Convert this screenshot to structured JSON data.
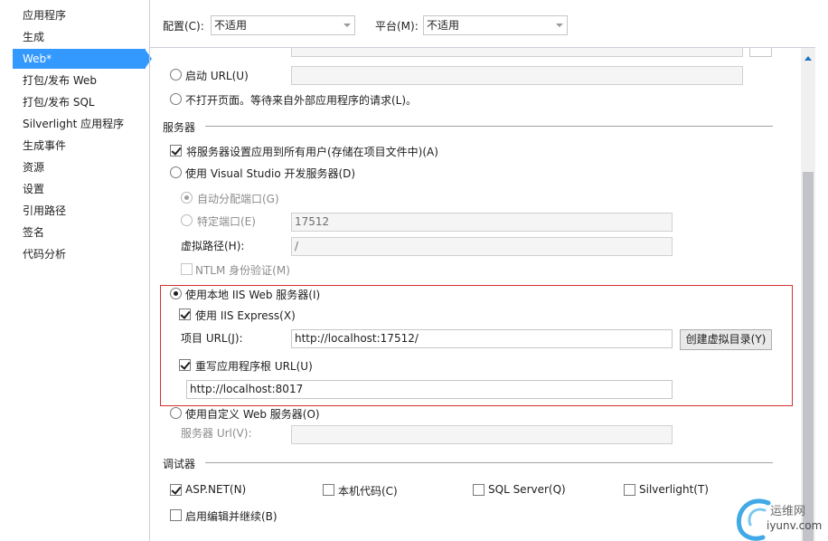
{
  "sidebar": {
    "items": [
      {
        "label": "应用程序"
      },
      {
        "label": "生成"
      },
      {
        "label": "Web*",
        "selected": true
      },
      {
        "label": "打包/发布 Web"
      },
      {
        "label": "打包/发布 SQL"
      },
      {
        "label": "Silverlight 应用程序"
      },
      {
        "label": "生成事件"
      },
      {
        "label": "资源"
      },
      {
        "label": "设置"
      },
      {
        "label": "引用路径"
      },
      {
        "label": "签名"
      },
      {
        "label": "代码分析"
      }
    ]
  },
  "toolbar": {
    "config_label": "配置(C):",
    "config_value": "不适用",
    "platform_label": "平台(M):",
    "platform_value": "不适用"
  },
  "start_action": {
    "start_url_label": "启动 URL(U)",
    "start_url_value": "",
    "no_open_label": "不打开页面。等待来自外部应用程序的请求(L)。"
  },
  "servers": {
    "title": "服务器",
    "apply_all_label": "将服务器设置应用到所有用户(存储在项目文件中)(A)",
    "apply_all_checked": true,
    "vs_dev_label": "使用 Visual Studio 开发服务器(D)",
    "auto_port_label": "自动分配端口(G)",
    "specific_port_label": "特定端口(E)",
    "specific_port_value": "17512",
    "virtual_path_label": "虚拟路径(H):",
    "virtual_path_value": "/",
    "ntlm_label": "NTLM 身份验证(M)",
    "local_iis_label": "使用本地 IIS Web 服务器(I)",
    "iis_express_label": "使用 IIS Express(X)",
    "iis_express_checked": true,
    "project_url_label": "项目 URL(J):",
    "project_url_value": "http://localhost:17512/",
    "create_vdir_button": "创建虚拟目录(Y)",
    "override_root_label": "重写应用程序根 URL(U)",
    "override_root_checked": true,
    "override_root_value": "http://localhost:8017",
    "custom_server_label": "使用自定义 Web 服务器(O)",
    "server_url_label": "服务器 Url(V):",
    "server_url_value": ""
  },
  "debuggers": {
    "title": "调试器",
    "aspnet_label": "ASP.NET(N)",
    "aspnet_checked": true,
    "native_label": "本机代码(C)",
    "native_checked": false,
    "sql_label": "SQL Server(Q)",
    "sql_checked": false,
    "silverlight_label": "Silverlight(T)",
    "silverlight_checked": false,
    "edit_continue_label": "启用编辑并继续(B)",
    "edit_continue_checked": false
  },
  "watermark": {
    "line1": "运维网",
    "line2": "iyunv.com"
  },
  "colors": {
    "selection": "#3399ff",
    "highlight_border": "#d03030"
  }
}
